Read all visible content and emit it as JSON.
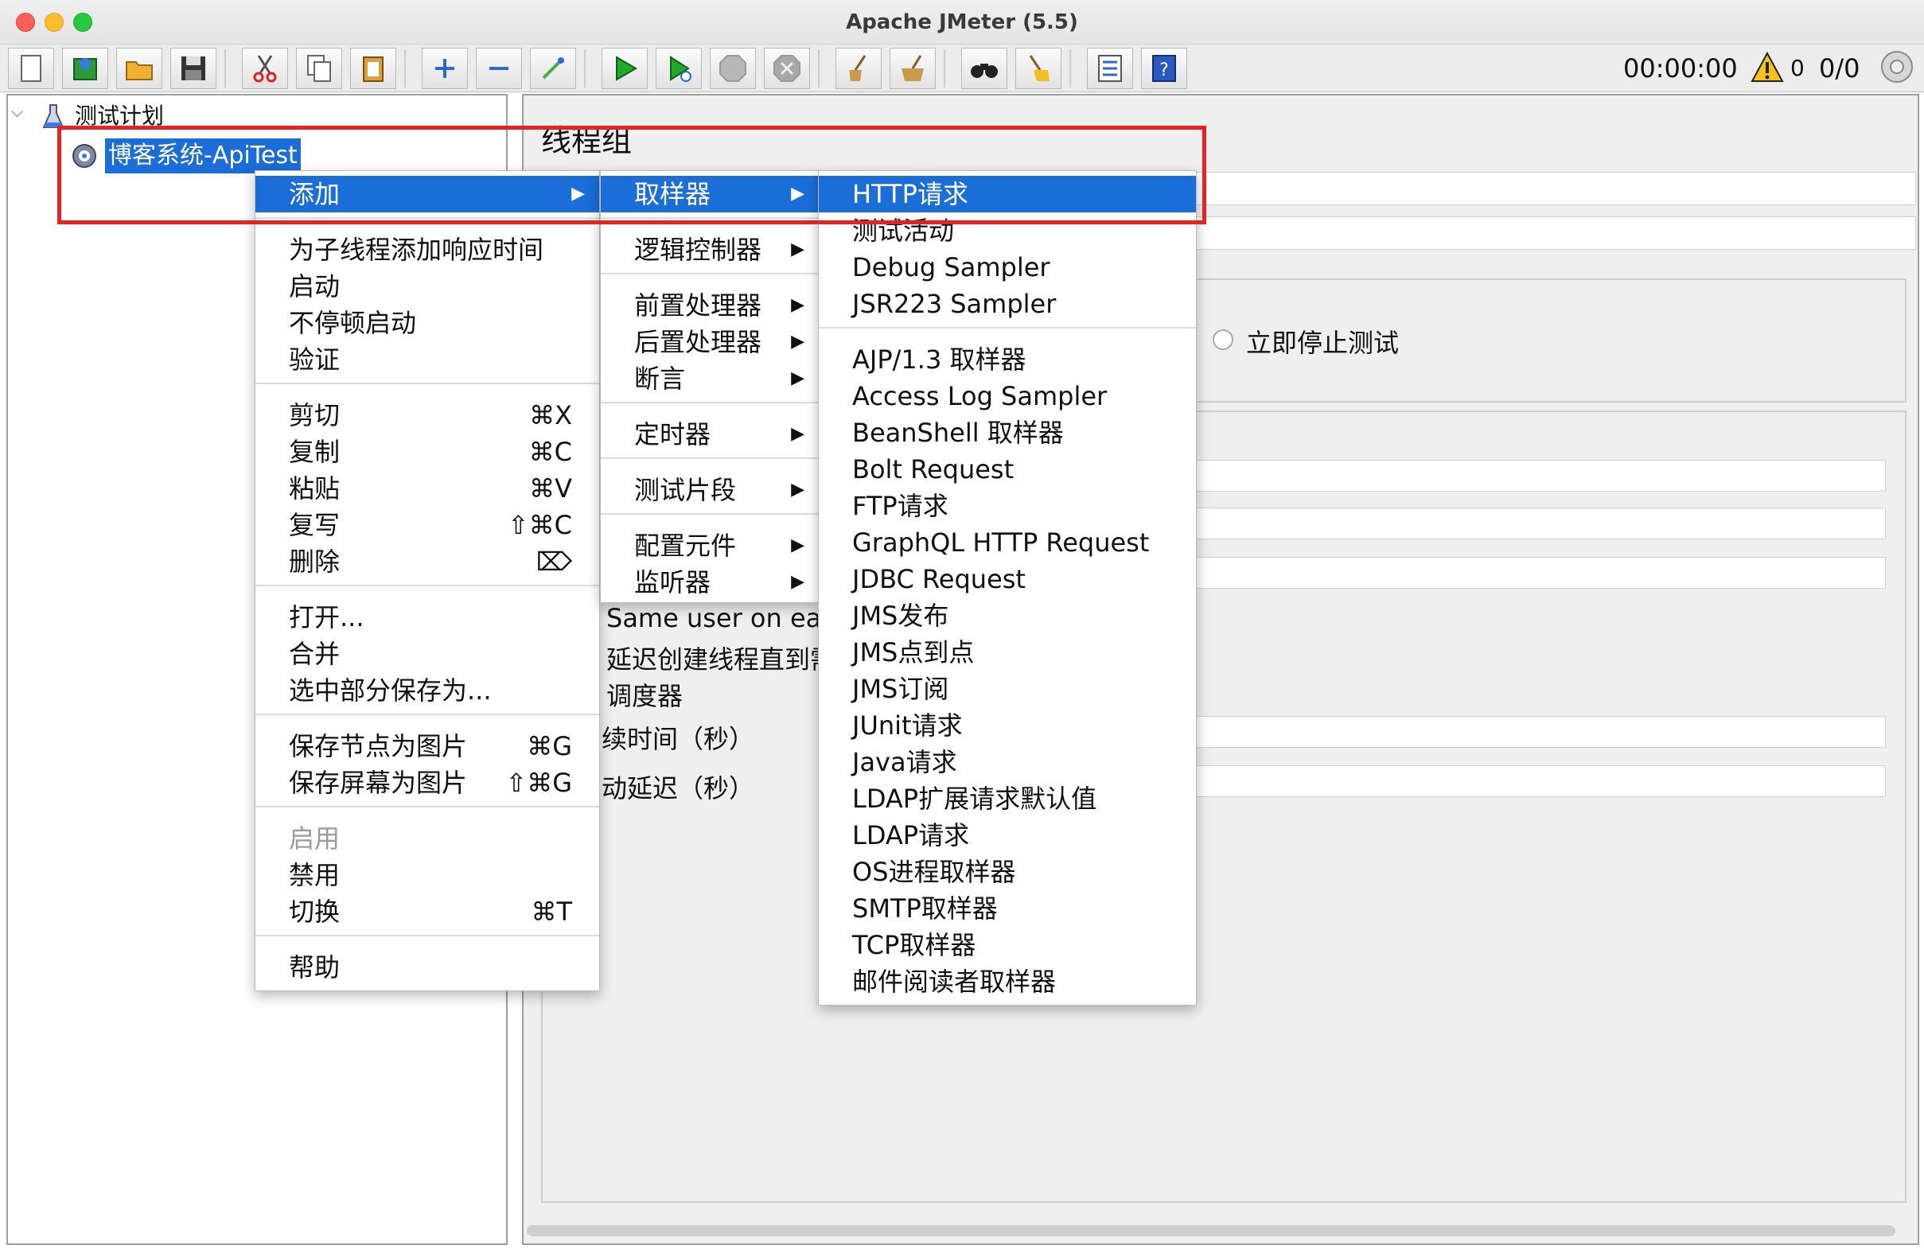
{
  "window": {
    "title": "Apache JMeter (5.5)"
  },
  "toolbar": {
    "timer": "00:00:00",
    "error_count": "0",
    "threads": "0/0"
  },
  "tree": {
    "root": "测试计划",
    "selected": "博客系统-ApiTest"
  },
  "background": {
    "panel_title": "线程组",
    "radio_label": "立即停止测试",
    "row1": "Same user on eac",
    "row2": "延迟创建线程直到需",
    "row3": "调度器",
    "row4": "续时间（秒）",
    "row5": "动延迟（秒）"
  },
  "context_menu": {
    "items": [
      {
        "label": "添加"
      },
      {
        "label": "为子线程添加响应时间"
      },
      {
        "label": "启动"
      },
      {
        "label": "不停顿启动"
      },
      {
        "label": "验证"
      },
      {
        "label": "剪切",
        "shortcut": "⌘X"
      },
      {
        "label": "复制",
        "shortcut": "⌘C"
      },
      {
        "label": "粘贴",
        "shortcut": "⌘V"
      },
      {
        "label": "复写",
        "shortcut": "⇧⌘C"
      },
      {
        "label": "删除",
        "shortcut": "⌦"
      },
      {
        "label": "打开..."
      },
      {
        "label": "合并"
      },
      {
        "label": "选中部分保存为..."
      },
      {
        "label": "保存节点为图片",
        "shortcut": "⌘G"
      },
      {
        "label": "保存屏幕为图片",
        "shortcut": "⇧⌘G"
      },
      {
        "label": "启用"
      },
      {
        "label": "禁用"
      },
      {
        "label": "切换",
        "shortcut": "⌘T"
      },
      {
        "label": "帮助"
      }
    ]
  },
  "add_menu": {
    "items": [
      {
        "label": "取样器"
      },
      {
        "label": "逻辑控制器"
      },
      {
        "label": "前置处理器"
      },
      {
        "label": "后置处理器"
      },
      {
        "label": "断言"
      },
      {
        "label": "定时器"
      },
      {
        "label": "测试片段"
      },
      {
        "label": "配置元件"
      },
      {
        "label": "监听器"
      }
    ]
  },
  "sampler_menu": {
    "items": [
      {
        "label": "HTTP请求"
      },
      {
        "label": "测试活动"
      },
      {
        "label": "Debug Sampler"
      },
      {
        "label": "JSR223 Sampler"
      },
      {
        "label": "AJP/1.3 取样器"
      },
      {
        "label": "Access Log Sampler"
      },
      {
        "label": "BeanShell 取样器"
      },
      {
        "label": "Bolt Request"
      },
      {
        "label": "FTP请求"
      },
      {
        "label": "GraphQL HTTP Request"
      },
      {
        "label": "JDBC Request"
      },
      {
        "label": "JMS发布"
      },
      {
        "label": "JMS点到点"
      },
      {
        "label": "JMS订阅"
      },
      {
        "label": "JUnit请求"
      },
      {
        "label": "Java请求"
      },
      {
        "label": "LDAP扩展请求默认值"
      },
      {
        "label": "LDAP请求"
      },
      {
        "label": "OS进程取样器"
      },
      {
        "label": "SMTP取样器"
      },
      {
        "label": "TCP取样器"
      },
      {
        "label": "邮件阅读者取样器"
      }
    ]
  },
  "colors": {
    "highlight": "#1b6dd8",
    "annotation": "#e62222"
  }
}
